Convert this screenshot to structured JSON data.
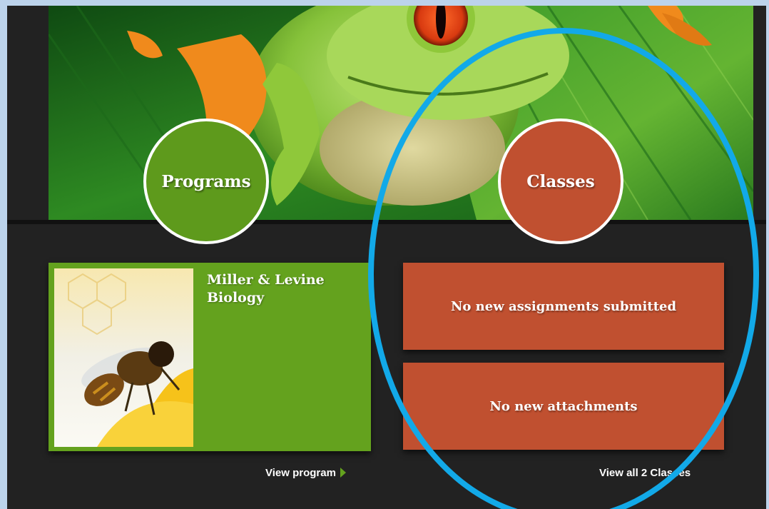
{
  "hero": {
    "programs_label": "Programs",
    "classes_label": "Classes"
  },
  "program_card": {
    "title": "Miller & Levine Biology",
    "view_link": "View program"
  },
  "classes_panel": {
    "assignments_status": "No new assignments submitted",
    "attachments_status": "No new attachments",
    "view_link": "View all 2 Classes"
  },
  "colors": {
    "programs_accent": "#64a21e",
    "classes_accent": "#c05030",
    "annotation_ring": "#12a9e8",
    "page_background": "#222222"
  },
  "icons": {
    "view_program_arrow": "triangle-right-icon"
  }
}
